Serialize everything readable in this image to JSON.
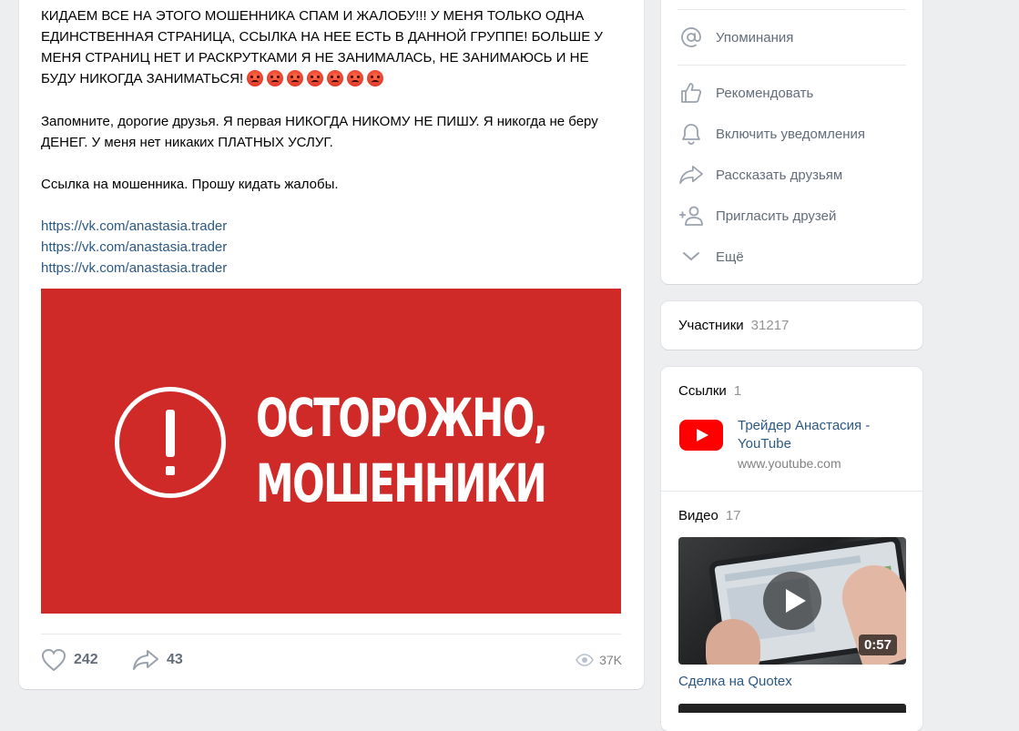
{
  "post": {
    "paragraph1": "КИДАЕМ ВСЕ НА ЭТОГО МОШЕННИКА СПАМ И ЖАЛОБУ!!! У МЕНЯ ТОЛЬКО ОДНА ЕДИНСТВЕННАЯ СТРАНИЦА, ССЫЛКА НА НЕЕ ЕСТЬ В ДАННОЙ ГРУППЕ! БОЛЬШЕ У МЕНЯ СТРАНИЦ НЕТ И РАСКРУТКАМИ Я НЕ ЗАНИМАЛАСЬ, НЕ ЗАНИМАЮСЬ И НЕ БУДУ НИКОГДА ЗАНИМАТЬСЯ!",
    "paragraph2": "Запомните, дорогие друзья. Я первая НИКОГДА НИКОМУ НЕ ПИШУ. Я никогда не беру ДЕНЕГ. У меня нет никаких ПЛАТНЫХ УСЛУГ.",
    "paragraph3": "Ссылка на мошенника. Прошу кидать жалобы.",
    "links": [
      "https://vk.com/anastasia.trader",
      "https://vk.com/anastasia.trader",
      "https://vk.com/anastasia.trader"
    ],
    "image_text_line1": "ОСТОРОЖНО,",
    "image_text_line2": "МОШЕННИКИ",
    "likes": "242",
    "shares": "43",
    "views": "37K"
  },
  "menu": {
    "mentions": "Упоминания",
    "recommend": "Рекомендовать",
    "notifications": "Включить уведомления",
    "tell_friends": "Рассказать друзьям",
    "invite_friends": "Пригласить друзей",
    "more": "Ещё"
  },
  "members": {
    "label": "Участники",
    "count": "31217"
  },
  "links_block": {
    "label": "Ссылки",
    "count": "1",
    "item_title": "Трейдер Анастасия - YouTube",
    "item_url": "www.youtube.com"
  },
  "video_block": {
    "label": "Видео",
    "count": "17",
    "duration": "0:57",
    "title": "Сделка на Quotex"
  },
  "colors": {
    "accent": "#2a5885",
    "warning_red": "#cf2a27",
    "icon_gray": "#99a2ad"
  }
}
